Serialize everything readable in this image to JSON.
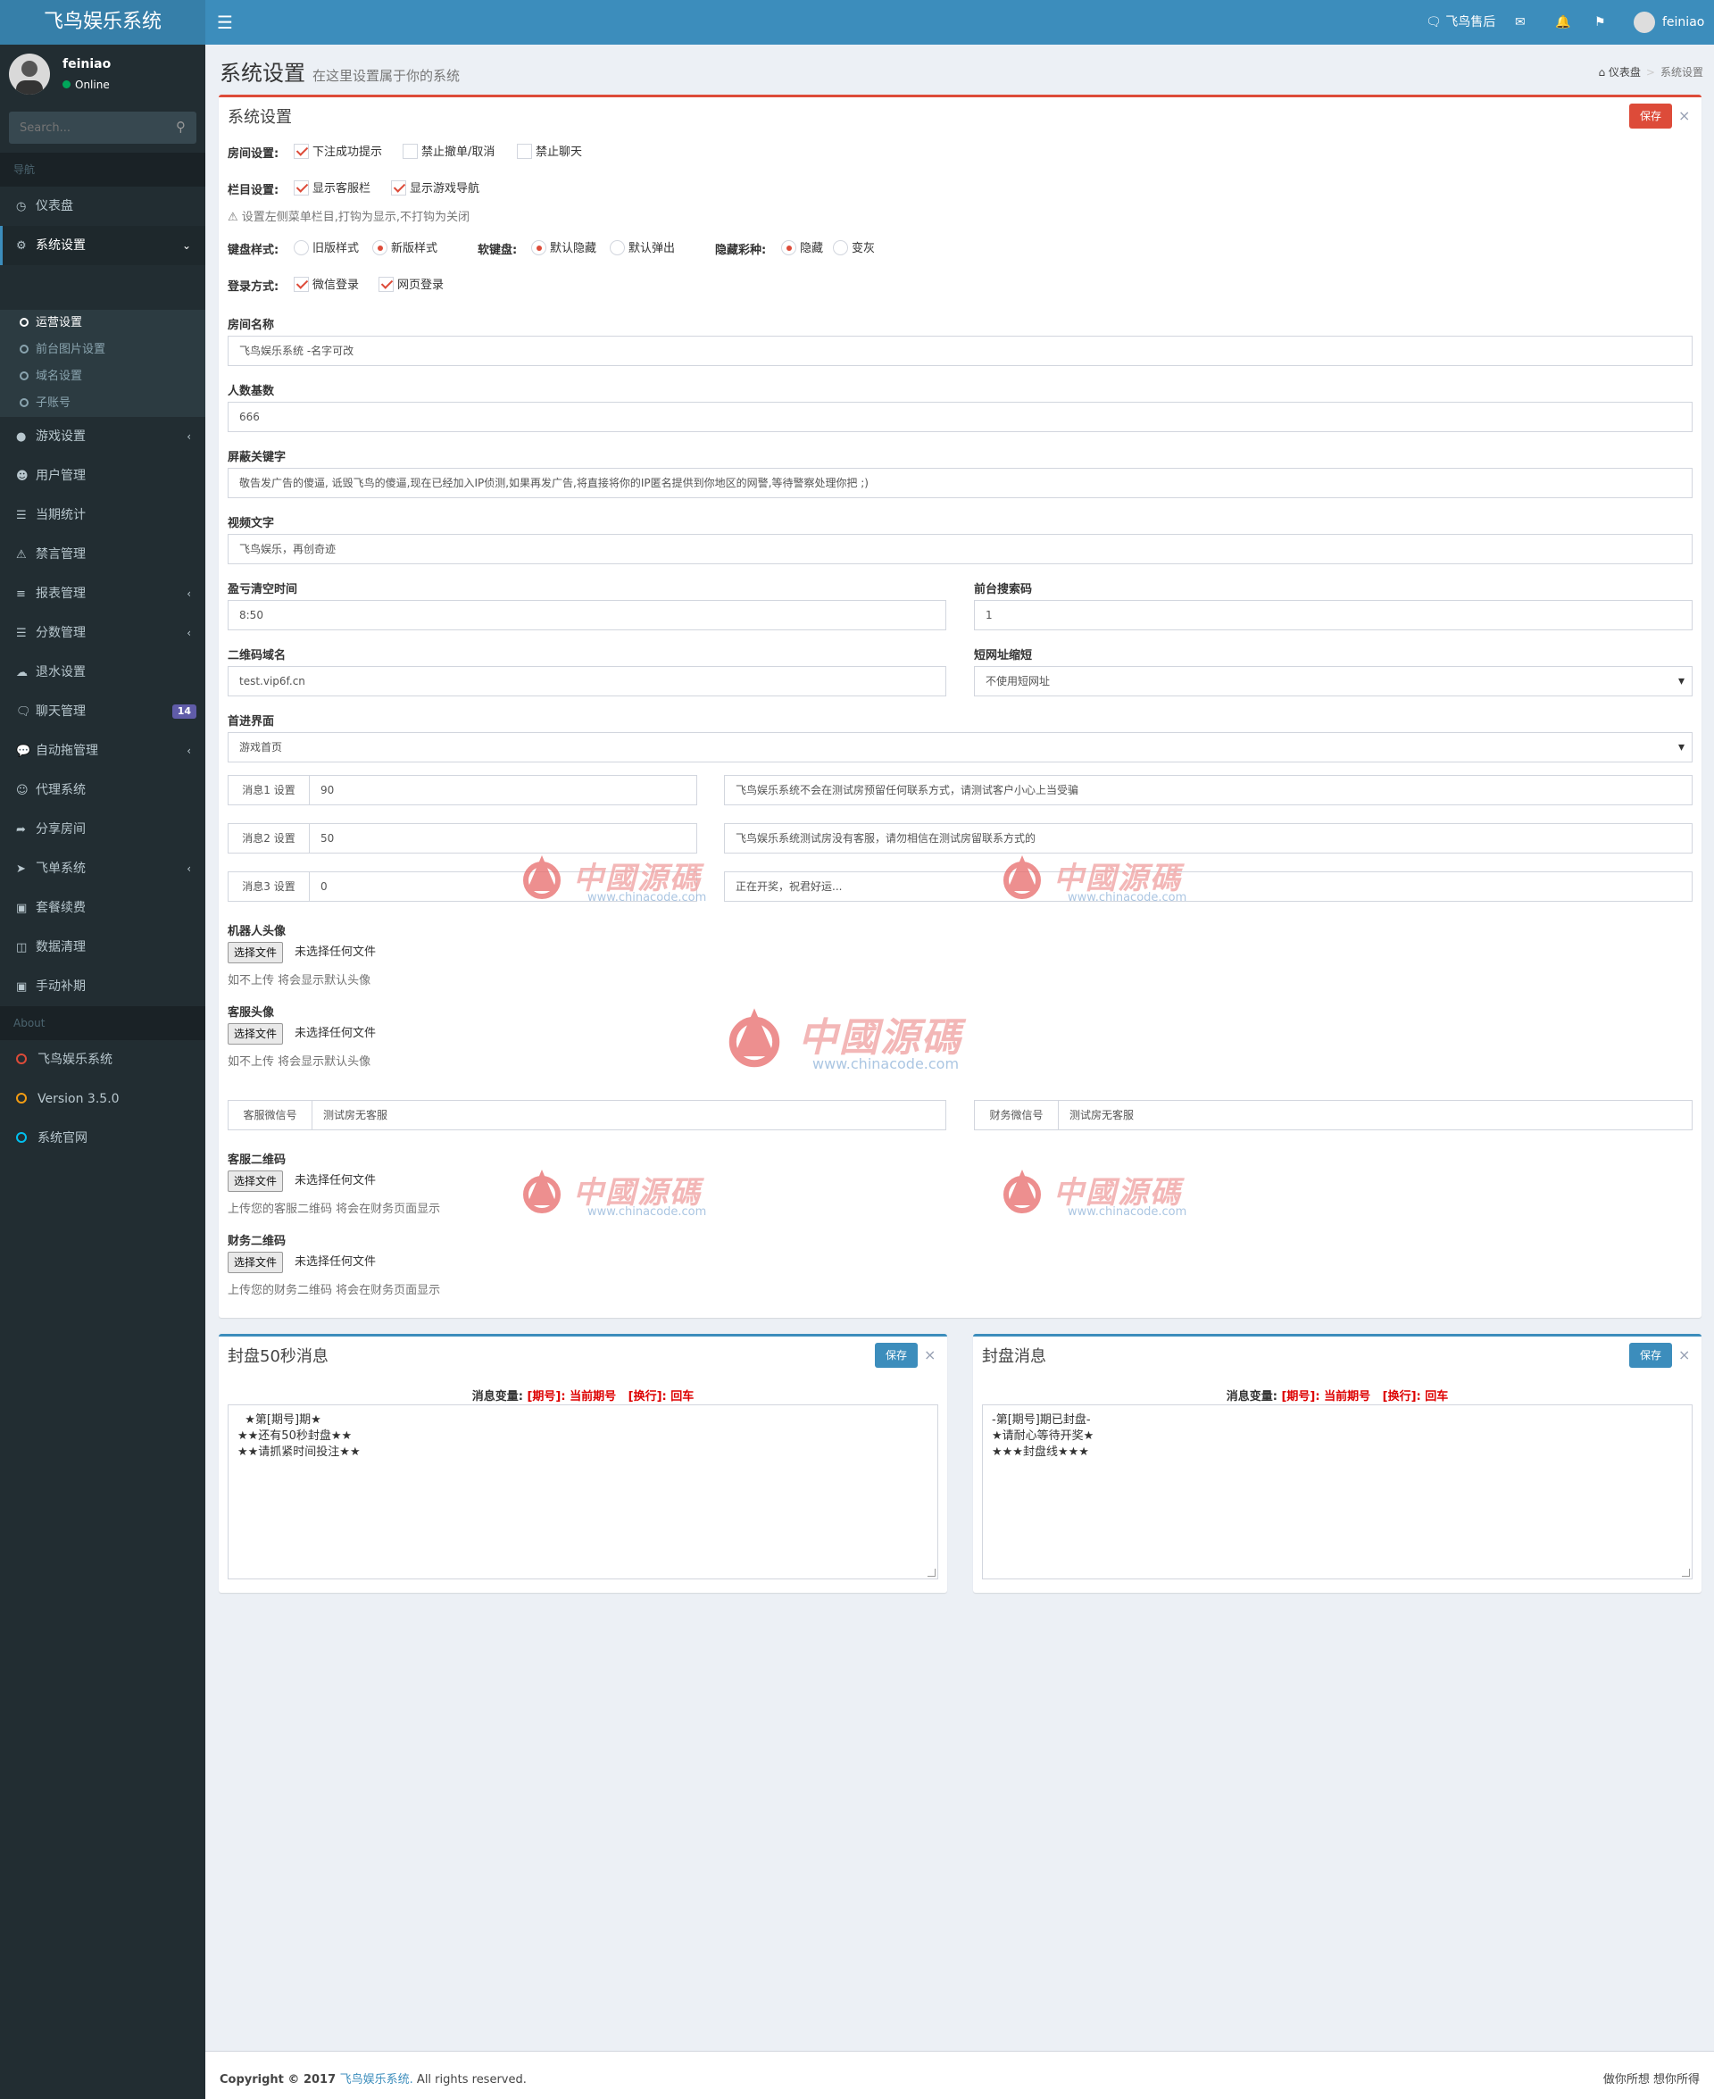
{
  "app": {
    "logo": "飞鸟娱乐系统"
  },
  "topnav": {
    "support": "飞鸟售后",
    "mail_icon": "envelope-icon",
    "bell_icon": "bell-icon",
    "flag_icon": "flag-icon",
    "username": "feiniao"
  },
  "sidebar": {
    "user": {
      "name": "feiniao",
      "status": "Online"
    },
    "search_placeholder": "Search...",
    "header_nav": "导航",
    "items": [
      {
        "label": "仪表盘",
        "icon": "dashboard-icon"
      },
      {
        "label": "系统设置",
        "icon": "cogs-icon"
      },
      {
        "label": "游戏设置",
        "icon": "gamepad-icon"
      },
      {
        "label": "用户管理",
        "icon": "users-icon"
      },
      {
        "label": "当期统计",
        "icon": "list-icon"
      },
      {
        "label": "禁言管理",
        "icon": "warning-icon"
      },
      {
        "label": "报表管理",
        "icon": "list-ul-icon"
      },
      {
        "label": "分数管理",
        "icon": "database-icon"
      },
      {
        "label": "退水设置",
        "icon": "cloud-upload-icon"
      },
      {
        "label": "聊天管理",
        "icon": "chat-icon",
        "badge": "14"
      },
      {
        "label": "自动拖管理",
        "icon": "comment-icon"
      },
      {
        "label": "代理系统",
        "icon": "user-plus-icon"
      },
      {
        "label": "分享房间",
        "icon": "share-icon"
      },
      {
        "label": "飞单系统",
        "icon": "paper-plane-icon"
      },
      {
        "label": "套餐续费",
        "icon": "cart-icon"
      },
      {
        "label": "数据清理",
        "icon": "trash-icon"
      },
      {
        "label": "手动补期",
        "icon": "cubes-icon"
      }
    ],
    "submenu": [
      "运营设置",
      "前台图片设置",
      "域名设置",
      "子账号"
    ],
    "header_about": "About",
    "about": [
      {
        "label": "飞鸟娱乐系统",
        "color": "#dd4b39"
      },
      {
        "label": "Version 3.5.0",
        "color": "#f39c12"
      },
      {
        "label": "系统官网",
        "color": "#00c0ef"
      }
    ]
  },
  "page": {
    "title": "系统设置",
    "subtitle": "在这里设置属于你的系统",
    "breadcrumb": [
      "仪表盘",
      "系统设置"
    ]
  },
  "settings": {
    "box_title": "系统设置",
    "save": "保存",
    "room_label": "房间设置:",
    "room_opts": [
      "下注成功提示",
      "禁止撤单/取消",
      "禁止聊天"
    ],
    "column_label": "栏目设置:",
    "column_opts": [
      "显示客服栏",
      "显示游戏导航"
    ],
    "column_hint": "设置左侧菜单栏目,打钩为显示,不打钩为关闭",
    "kb_label": "键盘样式:",
    "kb_opts": [
      "旧版样式",
      "新版样式"
    ],
    "softkb_label": "软键盘:",
    "softkb_opts": [
      "默认隐藏",
      "默认弹出"
    ],
    "hidecolor_label": "隐藏彩种:",
    "hidecolor_opts": [
      "隐藏",
      "变灰"
    ],
    "login_label": "登录方式:",
    "login_opts": [
      "微信登录",
      "网页登录"
    ],
    "room_name_label": "房间名称",
    "room_name": "飞鸟娱乐系统 -名字可改",
    "base_label": "人数基数",
    "base": "666",
    "keywords_label": "屏蔽关键字",
    "keywords": "敬告发广告的傻逼, 诋毁飞鸟的傻逼,现在已经加入IP侦测,如果再发广告,将直接将你的IP匿名提供到你地区的网警,等待警察处理你把 ;)",
    "video_label": "视频文字",
    "video": "飞鸟娱乐，再创奇迹",
    "clear_time_label": "盈亏清空时间",
    "clear_time": "8:50",
    "search_code_label": "前台搜索码",
    "search_code": "1",
    "qr_domain_label": "二维码域名",
    "qr_domain": "test.vip6f.cn",
    "short_url_label": "短网址缩短",
    "short_url": "不使用短网址",
    "entry_label": "首进界面",
    "entry": "游戏首页",
    "msgs": [
      {
        "label": "消息1 设置",
        "value": "90",
        "text": "飞鸟娱乐系统不会在测试房预留任何联系方式，请测试客户小心上当受骗"
      },
      {
        "label": "消息2 设置",
        "value": "50",
        "text": "飞鸟娱乐系统测试房没有客服，请勿相信在测试房留联系方式的"
      },
      {
        "label": "消息3 设置",
        "value": "0",
        "text": "正在开奖，祝君好运..."
      }
    ],
    "robot_avatar_label": "机器人头像",
    "file_btn": "选择文件",
    "file_none": "未选择任何文件",
    "robot_help": "如不上传 将会显示默认头像",
    "cs_avatar_label": "客服头像",
    "cs_help": "如不上传 将会显示默认头像",
    "cs_wechat_label": "客服微信号",
    "cs_wechat": "测试房无客服",
    "fin_wechat_label": "财务微信号",
    "fin_wechat": "测试房无客服",
    "cs_qr_label": "客服二维码",
    "cs_qr_help": "上传您的客服二维码 将会在财务页面显示",
    "fin_qr_label": "财务二维码",
    "fin_qr_help": "上传您的财务二维码 将会在财务页面显示"
  },
  "seal50": {
    "title": "封盘50秒消息",
    "save": "保存",
    "var_prefix": "消息变量: ",
    "var1": "[期号]: 当前期号",
    "var2": "[换行]: 回车",
    "text": "  ★第[期号]期★\n★★还有50秒封盘★★\n★★请抓紧时间投注★★"
  },
  "seal": {
    "title": "封盘消息",
    "save": "保存",
    "var_prefix": "消息变量: ",
    "var1": "[期号]: 当前期号",
    "var2": "[换行]: 回车",
    "text": "-第[期号]期已封盘-\n★请耐心等待开奖★\n★★★封盘线★★★"
  },
  "watermark": {
    "text": "中國源碼",
    "url": "www.chinacode.com"
  },
  "footer": {
    "copyright": "Copyright © 2017 ",
    "brand": "飞鸟娱乐系统.",
    "rights": " All rights reserved.",
    "right": "做你所想 想你所得"
  }
}
